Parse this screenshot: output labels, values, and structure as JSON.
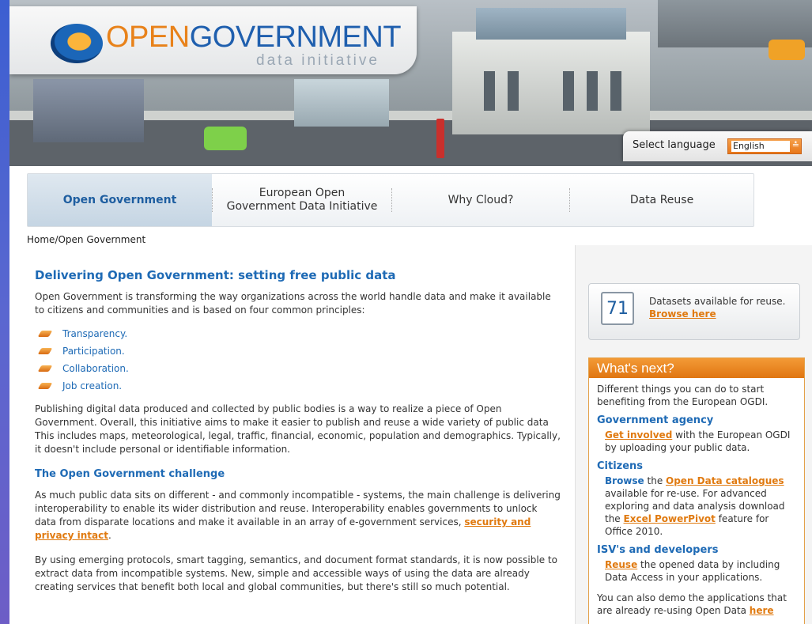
{
  "header": {
    "logo_part1": "OPEN",
    "logo_part2": "GOVERNMENT",
    "logo_subtitle": "data initiative",
    "language_label": "Select language",
    "language_value": "English"
  },
  "nav": {
    "items": [
      {
        "label": "Open Government",
        "active": true
      },
      {
        "label": "European Open\nGovernment Data Initiative",
        "active": false
      },
      {
        "label": "Why Cloud?",
        "active": false
      },
      {
        "label": "Data Reuse",
        "active": false
      }
    ]
  },
  "breadcrumb": "Home/Open Government",
  "main": {
    "title": "Delivering Open Government: setting free public data",
    "intro": "Open Government is transforming the way organizations across the world handle data and make it available to citizens and communities and is based on four common principles:",
    "principles": [
      "Transparency.",
      "Participation.",
      "Collaboration.",
      "Job creation."
    ],
    "para1": "Publishing digital data produced and collected by public bodies is a way to realize a piece of Open Government. Overall, this initiative aims to make it easier to publish and reuse a wide variety of public data This includes maps, meteorological, legal, traffic, financial, economic, population and demographics. Typically, it doesn't include personal or identifiable information.",
    "challenge_heading": "The Open Government challenge",
    "para2_before": "As much public data sits on different - and commonly incompatible - systems, the main challenge is delivering interoperability to enable its wider distribution and reuse. Interoperability enables governments to unlock data from disparate locations and make it available in an array of e-government services, ",
    "para2_link": "security and privacy intact",
    "para2_after": ".",
    "para3": "By using emerging protocols, smart tagging, semantics, and document format standards, it is now possible to extract data from incompatible systems. New, simple and accessible ways of using the data are already creating services that benefit both local and global communities, but there's still so much potential."
  },
  "sidebar": {
    "dataset_count": "71",
    "dataset_text": "Datasets available for reuse.",
    "dataset_link": "Browse here",
    "whats_next_title": "What's next?",
    "whats_next_intro": "Different things you can do to start benefiting from the European OGDI.",
    "gov_heading": "Government agency",
    "gov_link": "Get involved",
    "gov_text": " with the European OGDI by uploading your public data.",
    "citizens_heading": "Citizens",
    "citizens_browse": "Browse",
    "citizens_the": " the ",
    "citizens_link": "Open Data catalogues",
    "citizens_text": " available for re-use. For advanced exploring and data analysis download the ",
    "citizens_link2": "Excel PowerPivot",
    "citizens_text2": " feature for Office 2010.",
    "isv_heading": "ISV's and developers",
    "isv_link": "Reuse",
    "isv_text": " the opened data by including Data Access in your applications.",
    "demo_text": "You can also demo the applications that are already re-using Open Data ",
    "demo_link": "here"
  },
  "colors": {
    "accent_orange": "#e07a10",
    "link_blue": "#1e6ab5",
    "frame_blue": "#4a66c8"
  }
}
